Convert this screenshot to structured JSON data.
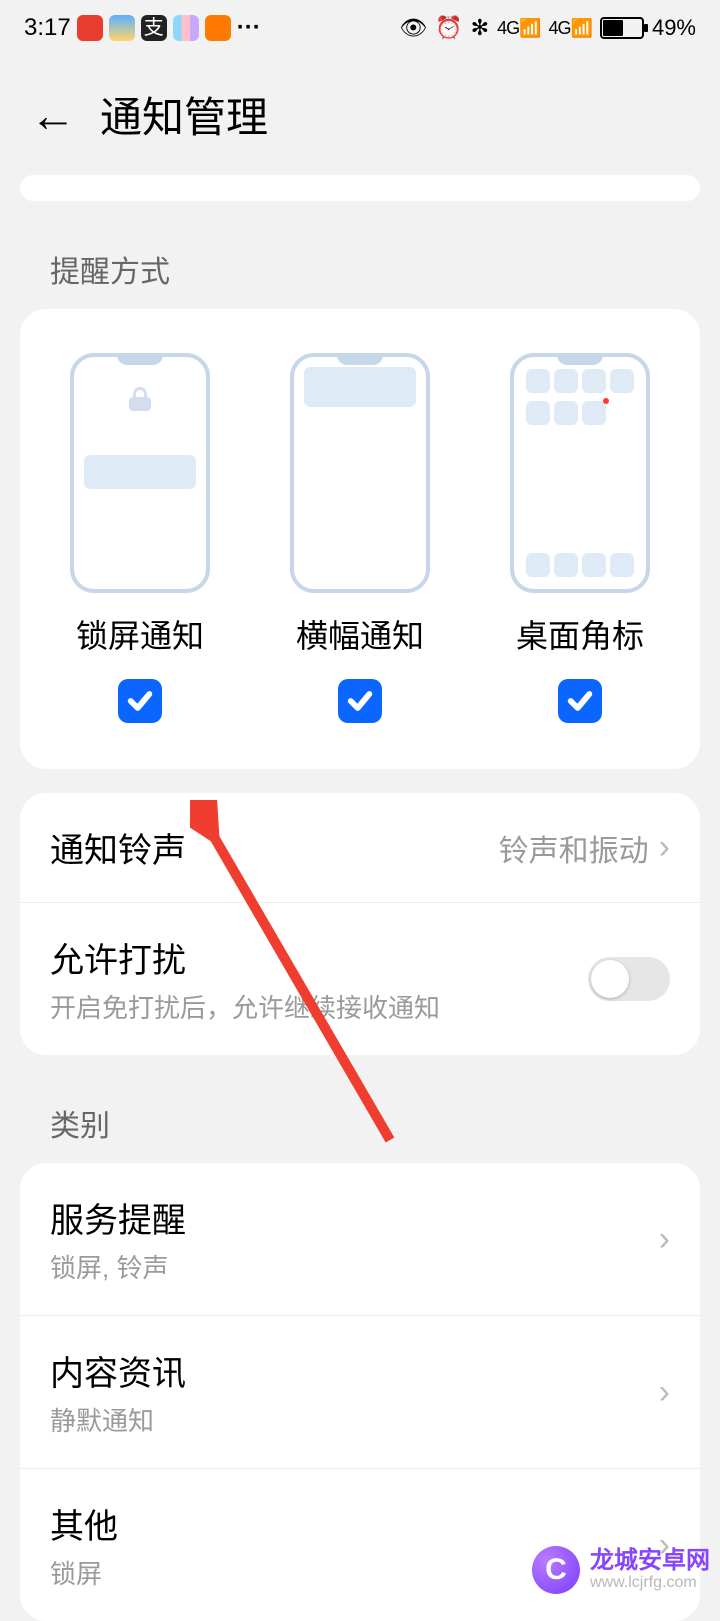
{
  "status": {
    "time": "3:17",
    "dots": "···",
    "battery_text": "49%",
    "sig1": "4G",
    "sig2": "4G"
  },
  "header": {
    "title": "通知管理"
  },
  "reminder": {
    "section_label": "提醒方式",
    "modes": [
      {
        "label": "锁屏通知",
        "checked": true
      },
      {
        "label": "横幅通知",
        "checked": true
      },
      {
        "label": "桌面角标",
        "checked": true
      }
    ]
  },
  "settings": {
    "sound": {
      "title": "通知铃声",
      "value": "铃声和振动"
    },
    "disturb": {
      "title": "允许打扰",
      "sub": "开启免打扰后，允许继续接收通知",
      "on": false
    }
  },
  "category": {
    "label": "类别",
    "items": [
      {
        "title": "服务提醒",
        "sub": "锁屏, 铃声"
      },
      {
        "title": "内容资讯",
        "sub": "静默通知"
      },
      {
        "title": "其他",
        "sub": "锁屏"
      }
    ]
  },
  "watermark": {
    "brand": "龙城安卓网",
    "url": "www.lcjrfg.com",
    "logo_letter": "C"
  }
}
